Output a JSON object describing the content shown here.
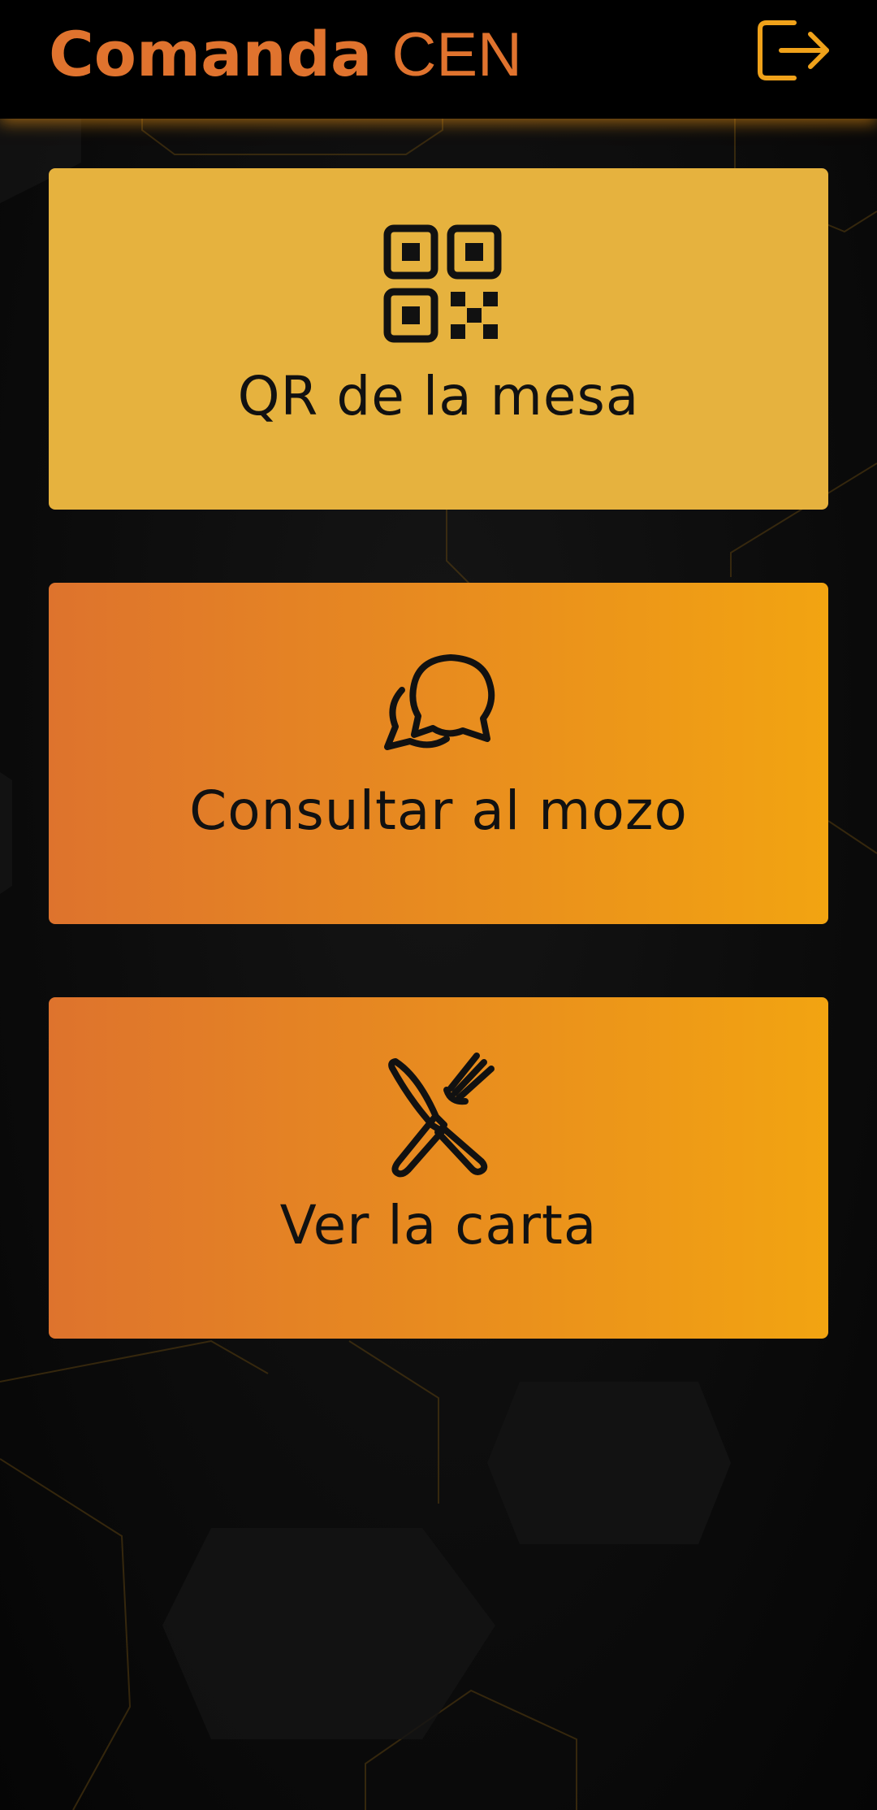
{
  "header": {
    "brand_bold": "Comanda",
    "brand_light": "CEN",
    "logout_icon": "logout-icon"
  },
  "cards": [
    {
      "label": "QR de la mesa",
      "icon": "qr-code-icon",
      "color": "#e6b23e"
    },
    {
      "label": "Consultar al mozo",
      "icon": "chat-bubbles-icon",
      "gradient": [
        "#de732d",
        "#f2a411"
      ]
    },
    {
      "label": "Ver la carta",
      "icon": "knife-fork-icon",
      "gradient": [
        "#de732d",
        "#f2a411"
      ]
    }
  ],
  "colors": {
    "brand": "#e0732e",
    "accent": "#f0a21a",
    "background": "#0b0b0b",
    "header": "#000000"
  }
}
